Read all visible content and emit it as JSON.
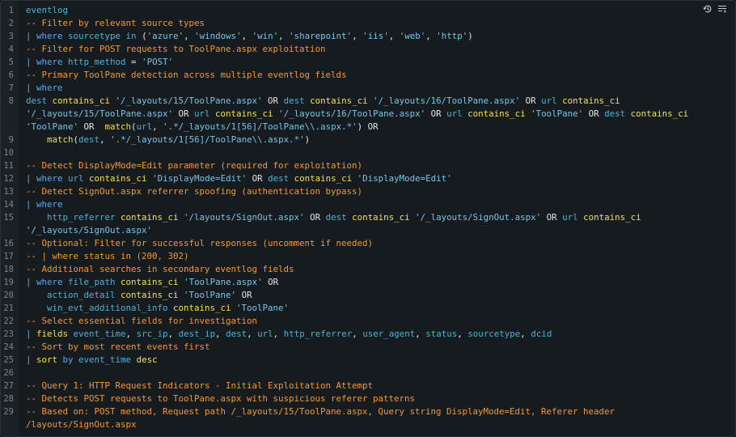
{
  "editor": {
    "toolbar": {
      "history_icon": "history-icon",
      "format_icon": "format-icon"
    },
    "lines": [
      {
        "num": "1",
        "tokens": [
          {
            "t": "eventlog",
            "c": "id"
          }
        ]
      },
      {
        "num": "2",
        "tokens": [
          {
            "t": "-- Filter by relevant source types",
            "c": "c"
          }
        ]
      },
      {
        "num": "3",
        "tokens": [
          {
            "t": "| ",
            "c": "op"
          },
          {
            "t": "where ",
            "c": "op"
          },
          {
            "t": "sourcetype ",
            "c": "id"
          },
          {
            "t": "in ",
            "c": "op"
          },
          {
            "t": "(",
            "c": "w"
          },
          {
            "t": "'azure'",
            "c": "s"
          },
          {
            "t": ", ",
            "c": "w"
          },
          {
            "t": "'windows'",
            "c": "s"
          },
          {
            "t": ", ",
            "c": "w"
          },
          {
            "t": "'win'",
            "c": "s"
          },
          {
            "t": ", ",
            "c": "w"
          },
          {
            "t": "'sharepoint'",
            "c": "s"
          },
          {
            "t": ", ",
            "c": "w"
          },
          {
            "t": "'iis'",
            "c": "s"
          },
          {
            "t": ", ",
            "c": "w"
          },
          {
            "t": "'web'",
            "c": "s"
          },
          {
            "t": ", ",
            "c": "w"
          },
          {
            "t": "'http'",
            "c": "s"
          },
          {
            "t": ")",
            "c": "w"
          }
        ]
      },
      {
        "num": "4",
        "tokens": [
          {
            "t": "-- Filter for POST requests to ToolPane.aspx exploitation",
            "c": "c"
          }
        ]
      },
      {
        "num": "5",
        "tokens": [
          {
            "t": "| ",
            "c": "op"
          },
          {
            "t": "where ",
            "c": "op"
          },
          {
            "t": "http_method ",
            "c": "id"
          },
          {
            "t": "= ",
            "c": "w"
          },
          {
            "t": "'POST'",
            "c": "s"
          }
        ]
      },
      {
        "num": "6",
        "tokens": [
          {
            "t": "-- Primary ToolPane detection across multiple eventlog fields",
            "c": "c"
          }
        ]
      },
      {
        "num": "7",
        "tokens": [
          {
            "t": "| ",
            "c": "op"
          },
          {
            "t": "where",
            "c": "op"
          }
        ]
      },
      {
        "num": "8",
        "tokens": [
          {
            "t": "dest ",
            "c": "id"
          },
          {
            "t": "contains_ci ",
            "c": "k"
          },
          {
            "t": "'/_layouts/15/ToolPane.aspx'",
            "c": "s"
          },
          {
            "t": " OR ",
            "c": "w"
          },
          {
            "t": "dest ",
            "c": "id"
          },
          {
            "t": "contains_ci ",
            "c": "k"
          },
          {
            "t": "'/_layouts/16/ToolPane.aspx'",
            "c": "s"
          },
          {
            "t": " OR ",
            "c": "w"
          },
          {
            "t": "url ",
            "c": "id"
          },
          {
            "t": "contains_ci",
            "c": "k"
          }
        ]
      },
      {
        "num": "",
        "tokens": [
          {
            "t": "'/_layouts/15/ToolPane.aspx'",
            "c": "s"
          },
          {
            "t": " OR ",
            "c": "w"
          },
          {
            "t": "url ",
            "c": "id"
          },
          {
            "t": "contains_ci ",
            "c": "k"
          },
          {
            "t": "'/_layouts/16/ToolPane.aspx'",
            "c": "s"
          },
          {
            "t": " OR ",
            "c": "w"
          },
          {
            "t": "url ",
            "c": "id"
          },
          {
            "t": "contains_ci ",
            "c": "k"
          },
          {
            "t": "'ToolPane'",
            "c": "s"
          },
          {
            "t": " OR ",
            "c": "w"
          },
          {
            "t": "dest ",
            "c": "id"
          },
          {
            "t": "contains_ci",
            "c": "k"
          }
        ]
      },
      {
        "num": "",
        "tokens": [
          {
            "t": "'ToolPane'",
            "c": "s"
          },
          {
            "t": " OR  ",
            "c": "w"
          },
          {
            "t": "match",
            "c": "k"
          },
          {
            "t": "(",
            "c": "w"
          },
          {
            "t": "url",
            "c": "id"
          },
          {
            "t": ", ",
            "c": "w"
          },
          {
            "t": "'.*/_layouts/1[56]/ToolPane\\\\.aspx.*'",
            "c": "s"
          },
          {
            "t": ") OR",
            "c": "w"
          }
        ]
      },
      {
        "num": "9",
        "tokens": [
          {
            "t": "    ",
            "c": "w"
          },
          {
            "t": "match",
            "c": "k"
          },
          {
            "t": "(",
            "c": "w"
          },
          {
            "t": "dest",
            "c": "id"
          },
          {
            "t": ", ",
            "c": "w"
          },
          {
            "t": "'.*/_layouts/1[56]/ToolPane\\\\.aspx.*'",
            "c": "s"
          },
          {
            "t": ")",
            "c": "w"
          }
        ]
      },
      {
        "num": "10",
        "tokens": []
      },
      {
        "num": "11",
        "tokens": [
          {
            "t": "-- Detect DisplayMode=Edit parameter (required for exploitation)",
            "c": "c"
          }
        ]
      },
      {
        "num": "12",
        "tokens": [
          {
            "t": "| ",
            "c": "op"
          },
          {
            "t": "where ",
            "c": "op"
          },
          {
            "t": "url ",
            "c": "id"
          },
          {
            "t": "contains_ci ",
            "c": "k"
          },
          {
            "t": "'DisplayMode=Edit'",
            "c": "s"
          },
          {
            "t": " OR ",
            "c": "w"
          },
          {
            "t": "dest ",
            "c": "id"
          },
          {
            "t": "contains_ci ",
            "c": "k"
          },
          {
            "t": "'DisplayMode=Edit'",
            "c": "s"
          }
        ]
      },
      {
        "num": "13",
        "tokens": [
          {
            "t": "-- Detect SignOut.aspx referrer spoofing (authentication bypass)",
            "c": "c"
          }
        ]
      },
      {
        "num": "14",
        "tokens": [
          {
            "t": "| ",
            "c": "op"
          },
          {
            "t": "where",
            "c": "op"
          }
        ]
      },
      {
        "num": "15",
        "tokens": [
          {
            "t": "    ",
            "c": "w"
          },
          {
            "t": "http_referrer ",
            "c": "id"
          },
          {
            "t": "contains_ci ",
            "c": "k"
          },
          {
            "t": "'/layouts/SignOut.aspx'",
            "c": "s"
          },
          {
            "t": " OR ",
            "c": "w"
          },
          {
            "t": "dest ",
            "c": "id"
          },
          {
            "t": "contains_ci ",
            "c": "k"
          },
          {
            "t": "'/_layouts/SignOut.aspx'",
            "c": "s"
          },
          {
            "t": " OR ",
            "c": "w"
          },
          {
            "t": "url ",
            "c": "id"
          },
          {
            "t": "contains_ci",
            "c": "k"
          }
        ]
      },
      {
        "num": "",
        "tokens": [
          {
            "t": "'/_layouts/SignOut.aspx'",
            "c": "s"
          }
        ]
      },
      {
        "num": "16",
        "tokens": [
          {
            "t": "-- Optional: Filter for successful responses (uncomment if needed)",
            "c": "c"
          }
        ]
      },
      {
        "num": "17",
        "tokens": [
          {
            "t": "-- | where status in (200, 302)",
            "c": "c"
          }
        ]
      },
      {
        "num": "18",
        "tokens": [
          {
            "t": "-- Additional searches in secondary eventlog fields",
            "c": "c"
          }
        ]
      },
      {
        "num": "19",
        "tokens": [
          {
            "t": "| ",
            "c": "op"
          },
          {
            "t": "where ",
            "c": "op"
          },
          {
            "t": "file_path ",
            "c": "id"
          },
          {
            "t": "contains_ci ",
            "c": "k"
          },
          {
            "t": "'ToolPane.aspx'",
            "c": "s"
          },
          {
            "t": " OR",
            "c": "w"
          }
        ]
      },
      {
        "num": "20",
        "tokens": [
          {
            "t": "    ",
            "c": "w"
          },
          {
            "t": "action_detail ",
            "c": "id"
          },
          {
            "t": "contains_ci ",
            "c": "k"
          },
          {
            "t": "'ToolPane'",
            "c": "s"
          },
          {
            "t": " OR",
            "c": "w"
          }
        ]
      },
      {
        "num": "21",
        "tokens": [
          {
            "t": "    ",
            "c": "w"
          },
          {
            "t": "win_evt_additional_info ",
            "c": "id"
          },
          {
            "t": "contains_ci ",
            "c": "k"
          },
          {
            "t": "'ToolPane'",
            "c": "s"
          }
        ]
      },
      {
        "num": "22",
        "tokens": [
          {
            "t": "-- Select essential fields for investigation",
            "c": "c"
          }
        ]
      },
      {
        "num": "23",
        "tokens": [
          {
            "t": "| ",
            "c": "op"
          },
          {
            "t": "fields ",
            "c": "k"
          },
          {
            "t": "event_time",
            "c": "id"
          },
          {
            "t": ", ",
            "c": "w"
          },
          {
            "t": "src_ip",
            "c": "id"
          },
          {
            "t": ", ",
            "c": "w"
          },
          {
            "t": "dest_ip",
            "c": "id"
          },
          {
            "t": ", ",
            "c": "w"
          },
          {
            "t": "dest",
            "c": "id"
          },
          {
            "t": ", ",
            "c": "w"
          },
          {
            "t": "url",
            "c": "id"
          },
          {
            "t": ", ",
            "c": "w"
          },
          {
            "t": "http_referrer",
            "c": "id"
          },
          {
            "t": ", ",
            "c": "w"
          },
          {
            "t": "user_agent",
            "c": "id"
          },
          {
            "t": ", ",
            "c": "w"
          },
          {
            "t": "status",
            "c": "id"
          },
          {
            "t": ", ",
            "c": "w"
          },
          {
            "t": "sourcetype",
            "c": "id"
          },
          {
            "t": ", ",
            "c": "w"
          },
          {
            "t": "dcid",
            "c": "id"
          }
        ]
      },
      {
        "num": "24",
        "tokens": [
          {
            "t": "-- Sort by most recent events first",
            "c": "c"
          }
        ]
      },
      {
        "num": "25",
        "tokens": [
          {
            "t": "| ",
            "c": "op"
          },
          {
            "t": "sort ",
            "c": "k"
          },
          {
            "t": "by ",
            "c": "op"
          },
          {
            "t": "event_time ",
            "c": "id"
          },
          {
            "t": "desc",
            "c": "k"
          }
        ]
      },
      {
        "num": "26",
        "tokens": []
      },
      {
        "num": "27",
        "tokens": [
          {
            "t": "-- Query 1: HTTP Request Indicators - Initial Exploitation Attempt",
            "c": "c"
          }
        ]
      },
      {
        "num": "28",
        "tokens": [
          {
            "t": "-- Detects POST requests to ToolPane.aspx with suspicious referer patterns",
            "c": "c"
          }
        ]
      },
      {
        "num": "29",
        "tokens": [
          {
            "t": "-- Based on: POST method, Request path /_layouts/15/ToolPane.aspx, Query string DisplayMode=Edit, Referer header",
            "c": "c"
          }
        ]
      },
      {
        "num": "",
        "tokens": [
          {
            "t": "/layouts/SignOut.aspx",
            "c": "c"
          }
        ]
      }
    ]
  }
}
